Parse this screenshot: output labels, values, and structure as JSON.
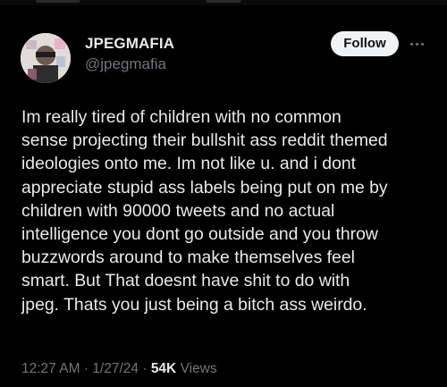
{
  "author": {
    "display_name": "JPEGMAFIA",
    "handle": "@jpegmafia"
  },
  "actions": {
    "follow_label": "Follow"
  },
  "tweet": {
    "lines": [
      "Im really tired of children with no common",
      "sense projecting their bullshit ass reddit themed",
      "ideologies onto me. Im not like u. and i dont",
      "appreciate stupid ass labels being put on me by",
      "children with 90000 tweets and no actual",
      "intelligence you dont go outside and you throw",
      "buzzwords around to make themselves feel",
      "smart. But That doesnt have shit to do with",
      "jpeg. Thats you just being a bitch ass weirdo."
    ]
  },
  "meta": {
    "time": "12:27 AM",
    "separator": "·",
    "date": "1/27/24",
    "views_count": "54K",
    "views_label": "Views"
  },
  "icons": {
    "more": "more-horizontal-icon"
  },
  "colors": {
    "background": "#000000",
    "primary_text": "#e7e9ea",
    "secondary_text": "#71767b",
    "follow_bg": "#eff3f4",
    "follow_text": "#0f1419"
  }
}
